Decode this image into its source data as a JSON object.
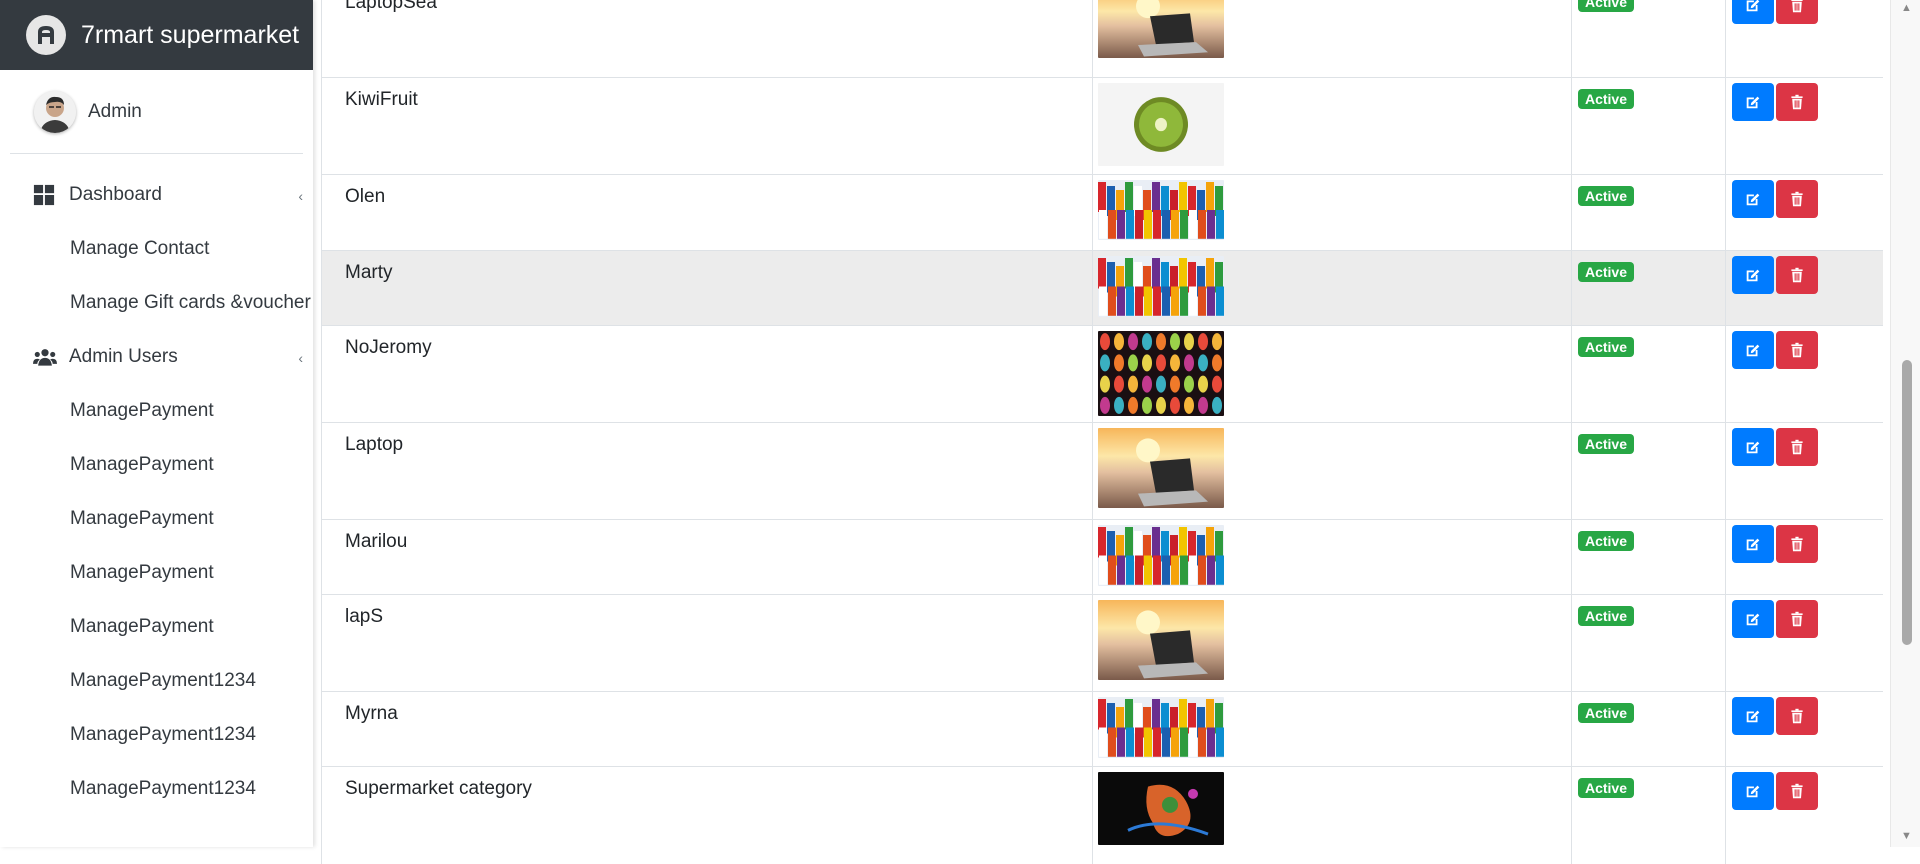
{
  "app": {
    "brand": "7rmart supermarket",
    "user": "Admin"
  },
  "sidebar": {
    "items": [
      {
        "label": "Dashboard",
        "icon": "dashboard-icon",
        "type": "top",
        "caret": "‹"
      },
      {
        "label": "Manage Contact",
        "type": "sub"
      },
      {
        "label": "Manage Gift cards &voucher",
        "type": "sub"
      },
      {
        "label": "Admin Users",
        "icon": "users-icon",
        "type": "top",
        "caret": "‹"
      },
      {
        "label": "ManagePayment",
        "type": "sub"
      },
      {
        "label": "ManagePayment",
        "type": "sub"
      },
      {
        "label": "ManagePayment",
        "type": "sub"
      },
      {
        "label": "ManagePayment",
        "type": "sub"
      },
      {
        "label": "ManagePayment",
        "type": "sub"
      },
      {
        "label": "ManagePayment1234",
        "type": "sub"
      },
      {
        "label": "ManagePayment1234",
        "type": "sub"
      },
      {
        "label": "ManagePayment1234",
        "type": "sub"
      }
    ]
  },
  "table": {
    "rows": [
      {
        "name": "LaptopSea",
        "image": "laptop",
        "status": "Active"
      },
      {
        "name": "KiwiFruit",
        "image": "kiwi",
        "status": "Active"
      },
      {
        "name": "Olen",
        "image": "groceries",
        "status": "Active"
      },
      {
        "name": "Marty",
        "image": "groceries",
        "status": "Active",
        "hover": true
      },
      {
        "name": "NoJeromy",
        "image": "lanterns",
        "status": "Active"
      },
      {
        "name": "Laptop",
        "image": "laptop",
        "status": "Active"
      },
      {
        "name": "Marilou",
        "image": "groceries",
        "status": "Active"
      },
      {
        "name": "lapS",
        "image": "laptop",
        "status": "Active"
      },
      {
        "name": "Myrna",
        "image": "groceries",
        "status": "Active"
      },
      {
        "name": "Supermarket category",
        "image": "dragon",
        "status": "Active"
      }
    ],
    "actions": {
      "edit_icon": "edit-icon",
      "delete_icon": "trash-icon"
    }
  },
  "colors": {
    "brand_bg": "#343a40",
    "active_badge": "#28a745",
    "edit": "#007bff",
    "delete": "#dc3545"
  }
}
